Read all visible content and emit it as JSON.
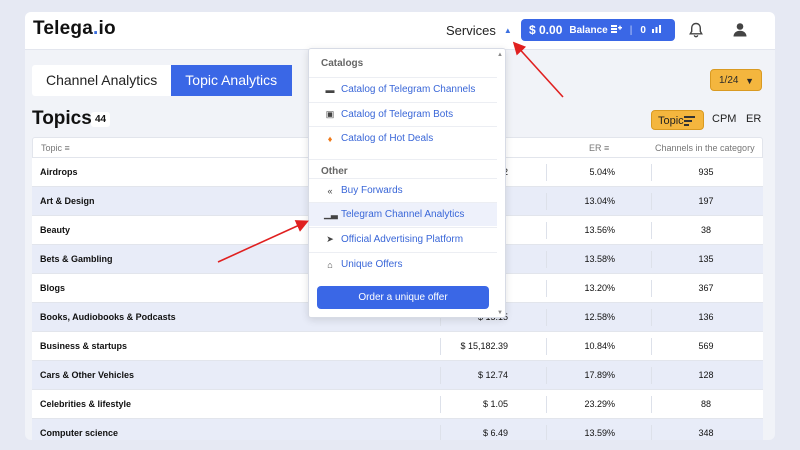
{
  "header": {
    "logo_main": "Telega",
    "logo_dot": ".",
    "logo_tld": "io",
    "services_label": "Services",
    "balance_amount": "$ 0.00",
    "balance_label": "Balance",
    "balance_count": "0"
  },
  "tabs": [
    {
      "label": "Channel Analytics",
      "active": false
    },
    {
      "label": "Topic Analytics",
      "active": true
    }
  ],
  "pager": "1/24",
  "topics": {
    "title": "Topics",
    "count": "44",
    "sort_options": [
      "Topic",
      "CPM",
      "ER"
    ],
    "active_sort": "Topic"
  },
  "table": {
    "headers": {
      "topic": "Topic",
      "er": "ER",
      "channels": "Channels in the category"
    },
    "rows": [
      {
        "topic": "Airdrops",
        "cpm": "2",
        "er": "5.04%",
        "channels": "935"
      },
      {
        "topic": "Art & Design",
        "cpm": "",
        "er": "13.04%",
        "channels": "197"
      },
      {
        "topic": "Beauty",
        "cpm": "",
        "er": "13.56%",
        "channels": "38"
      },
      {
        "topic": "Bets & Gambling",
        "cpm": "",
        "er": "13.58%",
        "channels": "135"
      },
      {
        "topic": "Blogs",
        "cpm": "",
        "er": "13.20%",
        "channels": "367"
      },
      {
        "topic": "Books, Audiobooks & Podcasts",
        "cpm": "$ 15.15",
        "er": "12.58%",
        "channels": "136"
      },
      {
        "topic": "Business & startups",
        "cpm": "$ 15,182.39",
        "er": "10.84%",
        "channels": "569"
      },
      {
        "topic": "Cars & Other Vehicles",
        "cpm": "$ 12.74",
        "er": "17.89%",
        "channels": "128"
      },
      {
        "topic": "Celebrities & lifestyle",
        "cpm": "$ 1.05",
        "er": "23.29%",
        "channels": "88"
      },
      {
        "topic": "Computer science",
        "cpm": "$ 6.49",
        "er": "13.59%",
        "channels": "348"
      }
    ]
  },
  "dropdown": {
    "section_catalogs": "Catalogs",
    "catalog_items": [
      {
        "label": "Catalog of Telegram Channels",
        "icon": "chat-icon"
      },
      {
        "label": "Catalog of Telegram Bots",
        "icon": "bot-icon"
      },
      {
        "label": "Catalog of Hot Deals",
        "icon": "fire-icon"
      }
    ],
    "section_other": "Other",
    "other_items": [
      {
        "label": "Buy Forwards",
        "icon": "forward-icon"
      },
      {
        "label": "Telegram Channel Analytics",
        "icon": "bar-chart-icon",
        "highlighted": true
      },
      {
        "label": "Official Advertising Platform",
        "icon": "send-icon"
      },
      {
        "label": "Unique Offers",
        "icon": "basket-icon"
      }
    ],
    "button_label": "Order a unique offer"
  },
  "colors": {
    "primary": "#3a67e6",
    "accent": "#f4b63e",
    "annotation": "#e02020"
  }
}
